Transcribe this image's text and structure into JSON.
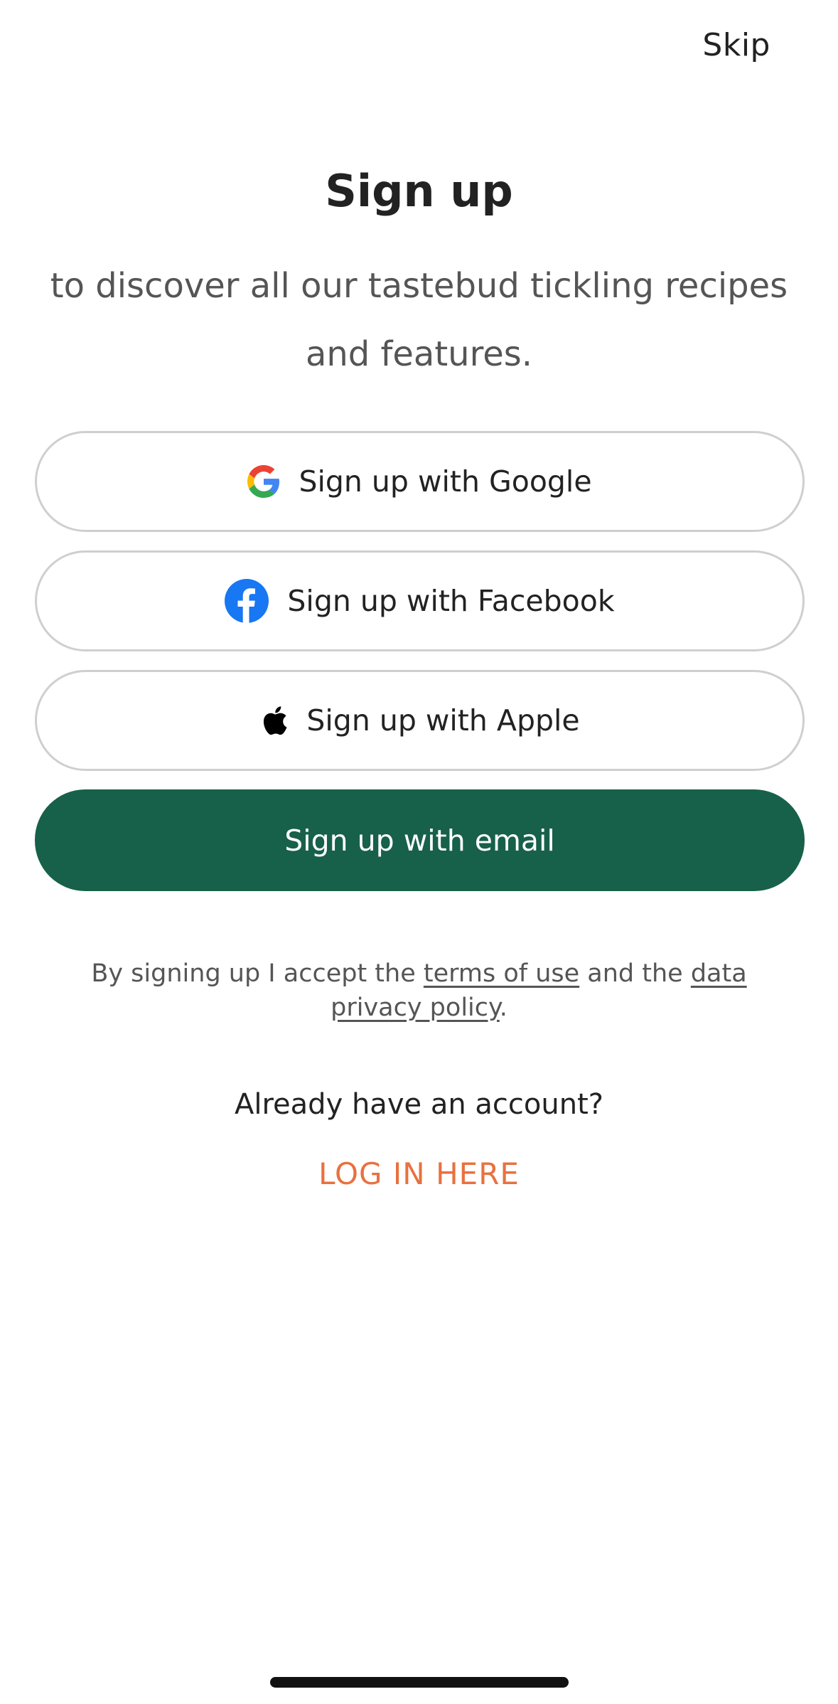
{
  "header": {
    "skip_label": "Skip"
  },
  "main": {
    "title": "Sign up",
    "subtitle": "to discover all our tastebud tickling recipes and features."
  },
  "buttons": {
    "google": {
      "label": "Sign up with Google",
      "icon": "google-icon"
    },
    "facebook": {
      "label": "Sign up with Facebook",
      "icon": "facebook-icon"
    },
    "apple": {
      "label": "Sign up with Apple",
      "icon": "apple-icon"
    },
    "email": {
      "label": "Sign up with email"
    }
  },
  "legal": {
    "prefix": "By signing up I accept the ",
    "terms_link": "terms of use",
    "middle": " and the ",
    "privacy_link": "data privacy policy",
    "suffix": "."
  },
  "login": {
    "question": "Already have an account?",
    "link_label": "LOG IN HERE"
  },
  "colors": {
    "primary_green": "#17604a",
    "accent_orange": "#e8713f",
    "facebook_blue": "#1877f2",
    "border_gray": "#cfcfcf"
  }
}
